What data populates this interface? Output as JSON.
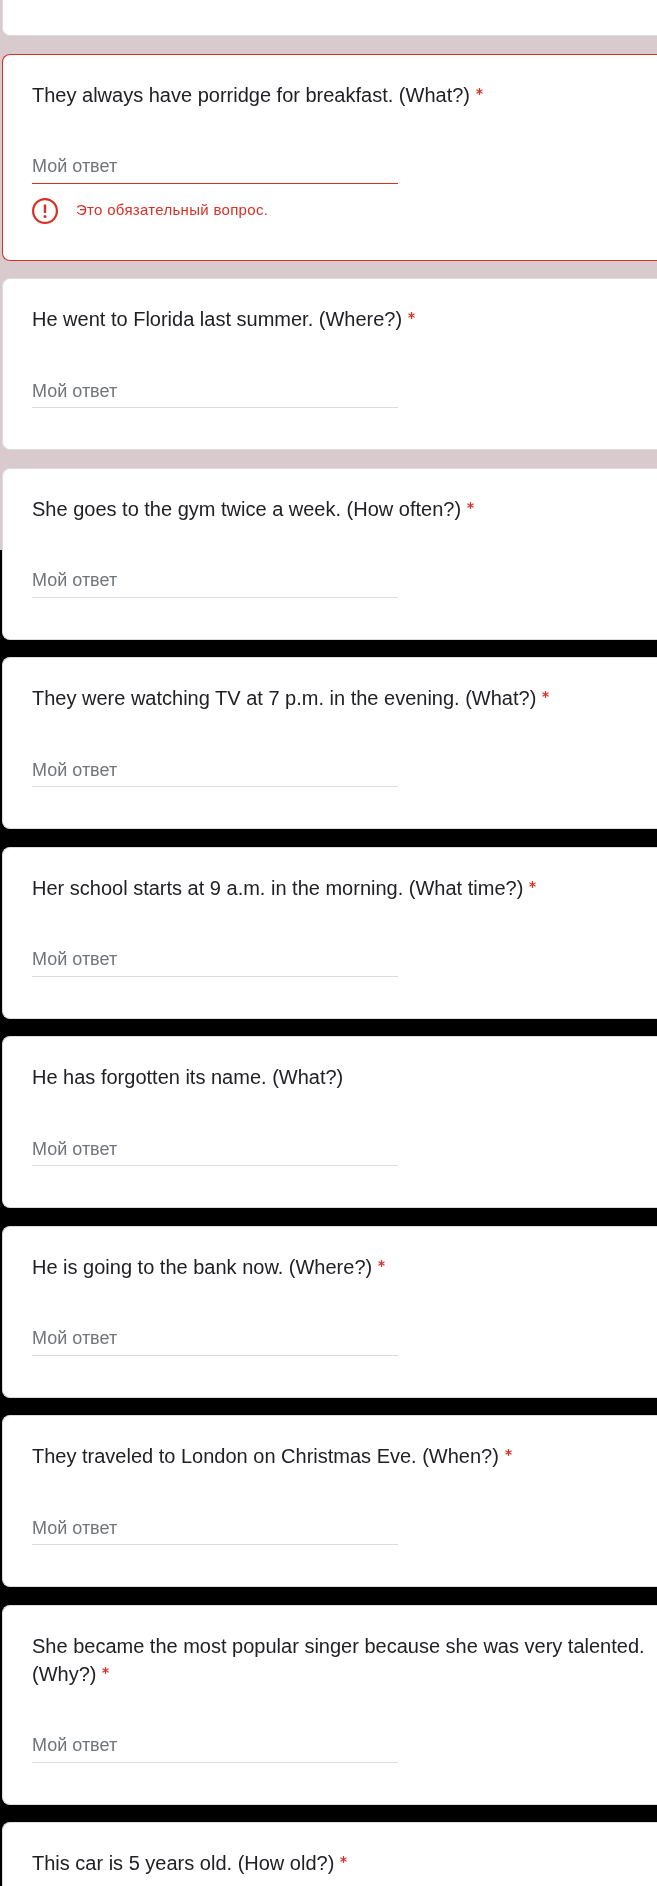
{
  "questions": [
    {
      "text": "They always have porridge for breakfast. (What?)",
      "required": true,
      "placeholder": "Мой ответ",
      "invalid": true,
      "error_message": "Это обязательный вопрос."
    },
    {
      "text": "He went to Florida last summer. (Where?)",
      "required": true,
      "placeholder": "Мой ответ",
      "invalid": false
    },
    {
      "text": "She goes to the gym twice a week. (How often?)",
      "required": true,
      "placeholder": "Мой ответ",
      "invalid": false
    },
    {
      "text": "They were watching TV at 7 p.m. in the evening. (What?)",
      "required": true,
      "placeholder": "Мой ответ",
      "invalid": false
    },
    {
      "text": "Her school starts at 9 a.m. in the morning. (What time?)",
      "required": true,
      "placeholder": "Мой ответ",
      "invalid": false
    },
    {
      "text": "He has forgotten its name. (What?)",
      "required": false,
      "placeholder": "Мой ответ",
      "invalid": false
    },
    {
      "text": "He is going to the bank now. (Where?)",
      "required": true,
      "placeholder": "Мой ответ",
      "invalid": false
    },
    {
      "text": "They traveled to London on Christmas Eve. (When?)",
      "required": true,
      "placeholder": "Мой ответ",
      "invalid": false
    },
    {
      "text": "She became the most popular singer because she was very talented. (Why?)",
      "required": true,
      "placeholder": "Мой ответ",
      "invalid": false
    },
    {
      "text": "This car is 5 years old. (How old?)",
      "required": true,
      "invalid": false
    }
  ]
}
